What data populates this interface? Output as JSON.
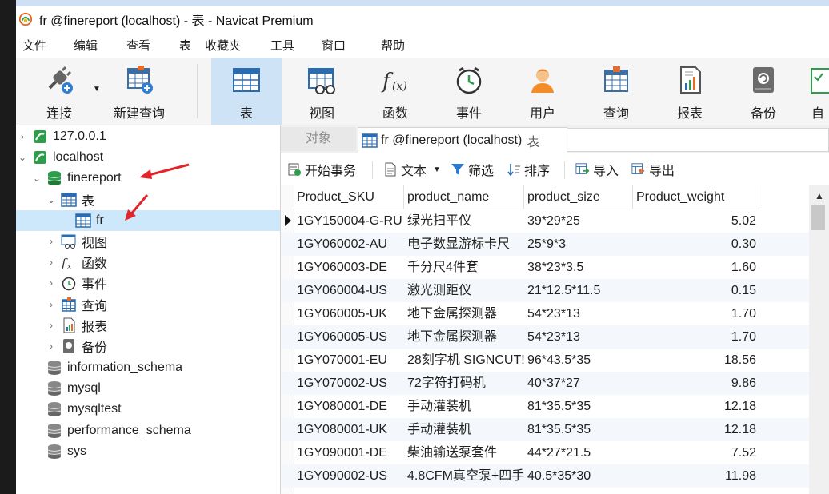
{
  "window": {
    "title": "fr @finereport (localhost) - 表 - Navicat Premium"
  },
  "menu": [
    "文件",
    "编辑",
    "查看",
    "表",
    "收藏夹",
    "工具",
    "窗口",
    "帮助"
  ],
  "toolbar": [
    {
      "label": "连接",
      "icon": "plug-connect-icon"
    },
    {
      "label": "新建查询",
      "icon": "new-query-icon"
    },
    {
      "label": "表",
      "icon": "table-icon",
      "active": true
    },
    {
      "label": "视图",
      "icon": "view-icon"
    },
    {
      "label": "函数",
      "icon": "function-icon"
    },
    {
      "label": "事件",
      "icon": "clock-event-icon"
    },
    {
      "label": "用户",
      "icon": "user-icon"
    },
    {
      "label": "查询",
      "icon": "query-icon"
    },
    {
      "label": "报表",
      "icon": "report-icon"
    },
    {
      "label": "备份",
      "icon": "backup-icon"
    },
    {
      "label": "自动",
      "icon": "automation-icon"
    }
  ],
  "tree": [
    {
      "label": "127.0.0.1",
      "level": 0,
      "arrow": "›",
      "icon": "connection-icon"
    },
    {
      "label": "localhost",
      "level": 0,
      "arrow": "⌄",
      "icon": "connection-icon"
    },
    {
      "label": "finereport",
      "level": 1,
      "arrow": "⌄",
      "icon": "database-icon"
    },
    {
      "label": "表",
      "level": 2,
      "arrow": "⌄",
      "icon": "table-icon"
    },
    {
      "label": "fr",
      "level": 3,
      "arrow": "",
      "icon": "table-icon",
      "selected": true
    },
    {
      "label": "视图",
      "level": 2,
      "arrow": "›",
      "icon": "view-icon"
    },
    {
      "label": "函数",
      "level": 2,
      "arrow": "›",
      "icon": "function-icon"
    },
    {
      "label": "事件",
      "level": 2,
      "arrow": "›",
      "icon": "clock-event-icon"
    },
    {
      "label": "查询",
      "level": 2,
      "arrow": "›",
      "icon": "query-icon"
    },
    {
      "label": "报表",
      "level": 2,
      "arrow": "›",
      "icon": "report-icon"
    },
    {
      "label": "备份",
      "level": 2,
      "arrow": "›",
      "icon": "backup-icon"
    },
    {
      "label": "information_schema",
      "level": 1,
      "arrow": "",
      "icon": "database-icon"
    },
    {
      "label": "mysql",
      "level": 1,
      "arrow": "",
      "icon": "database-icon"
    },
    {
      "label": "mysqltest",
      "level": 1,
      "arrow": "",
      "icon": "database-icon"
    },
    {
      "label": "performance_schema",
      "level": 1,
      "arrow": "",
      "icon": "database-icon"
    },
    {
      "label": "sys",
      "level": 1,
      "arrow": "",
      "icon": "database-icon"
    }
  ],
  "tabs": {
    "objects": "对象",
    "active": "fr @finereport (localhost)",
    "active_suffix": "表"
  },
  "subtoolbar": {
    "begin_tx": "开始事务",
    "text": "文本",
    "filter": "筛选",
    "sort": "排序",
    "import": "导入",
    "export": "导出"
  },
  "grid": {
    "columns": [
      "Product_SKU",
      "product_name",
      "product_size",
      "Product_weight"
    ],
    "rows": [
      [
        "1GY150004-G-RU",
        "绿光扫平仪",
        "39*29*25",
        "5.02"
      ],
      [
        "1GY060002-AU",
        "电子数显游标卡尺",
        "25*9*3",
        "0.30"
      ],
      [
        "1GY060003-DE",
        "千分尺4件套",
        "38*23*3.5",
        "1.60"
      ],
      [
        "1GY060004-US",
        "激光测距仪",
        "21*12.5*11.5",
        "0.15"
      ],
      [
        "1GY060005-UK",
        "地下金属探测器",
        "54*23*13",
        "1.70"
      ],
      [
        "1GY060005-US",
        "地下金属探测器",
        "54*23*13",
        "1.70"
      ],
      [
        "1GY070001-EU",
        "28刻字机 SIGNCUT!",
        "96*43.5*35",
        "18.56"
      ],
      [
        "1GY070002-US",
        "72字符打码机",
        "40*37*27",
        "9.86"
      ],
      [
        "1GY080001-DE",
        "手动灌装机",
        "81*35.5*35",
        "12.18"
      ],
      [
        "1GY080001-UK",
        "手动灌装机",
        "81*35.5*35",
        "12.18"
      ],
      [
        "1GY090001-DE",
        "柴油输送泵套件",
        "44*27*21.5",
        "7.52"
      ],
      [
        "1GY090002-US",
        "4.8CFM真空泵+四手",
        "40.5*35*30",
        "11.98"
      ]
    ]
  }
}
